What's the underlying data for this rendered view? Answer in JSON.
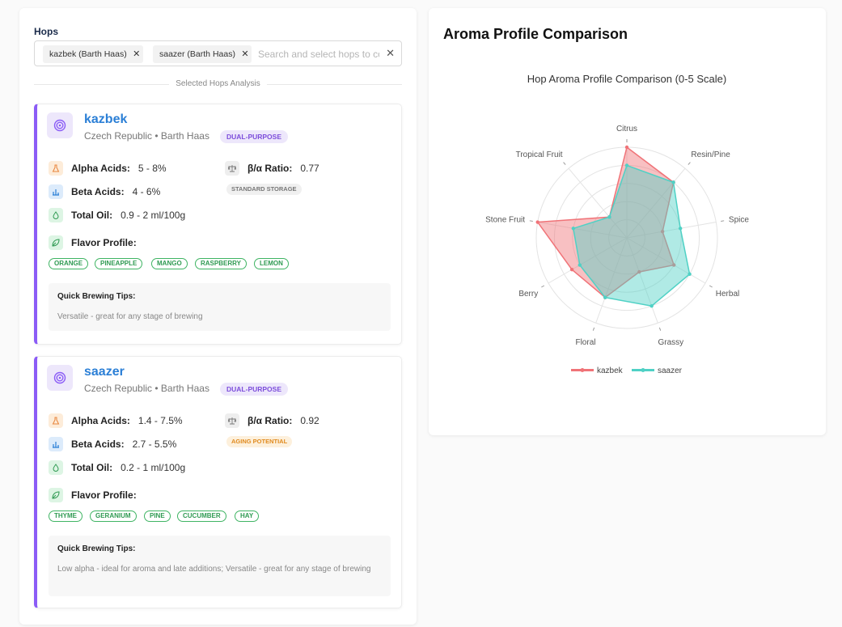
{
  "selector": {
    "label": "Hops",
    "selected": [
      {
        "label": "kazbek (Barth Haas)"
      },
      {
        "label": "saazer (Barth Haas)"
      }
    ],
    "placeholder": "Search and select hops to compare",
    "divider_text": "Selected Hops Analysis"
  },
  "hops": [
    {
      "name": "kazbek",
      "origin": "Czech Republic • Barth Haas",
      "purpose": "DUAL-PURPOSE",
      "alpha_label": "Alpha Acids:",
      "alpha": "5 - 8%",
      "ratio_label": "β/α Ratio:",
      "ratio": "0.77",
      "storage": "STANDARD STORAGE",
      "beta_label": "Beta Acids:",
      "beta": "4 - 6%",
      "oil_label": "Total Oil:",
      "oil": "0.9 - 2 ml/100g",
      "flavor_label": "Flavor Profile:",
      "flavors": [
        "ORANGE",
        "PINEAPPLE",
        "MANGO",
        "RASPBERRY",
        "LEMON"
      ],
      "tips_title": "Quick Brewing Tips:",
      "tips": "Versatile - great for any stage of brewing"
    },
    {
      "name": "saazer",
      "origin": "Czech Republic • Barth Haas",
      "purpose": "DUAL-PURPOSE",
      "alpha_label": "Alpha Acids:",
      "alpha": "1.4 - 7.5%",
      "ratio_label": "β/α Ratio:",
      "ratio": "0.92",
      "storage": "AGING POTENTIAL",
      "beta_label": "Beta Acids:",
      "beta": "2.7 - 5.5%",
      "oil_label": "Total Oil:",
      "oil": "0.2 - 1 ml/100g",
      "flavor_label": "Flavor Profile:",
      "flavors": [
        "THYME",
        "GERANIUM",
        "PINE",
        "CUCUMBER",
        "HAY"
      ],
      "tips_title": "Quick Brewing Tips:",
      "tips": "Low alpha - ideal for aroma and late additions; Versatile - great for any stage of brewing"
    }
  ],
  "chart_panel": {
    "title": "Aroma Profile Comparison"
  },
  "colors": {
    "kazbek": "#f07378",
    "saazer": "#4fd1c5",
    "accent": "#8b5cf6",
    "link": "#2b7fd6"
  },
  "chart_data": {
    "type": "radar",
    "title": "Hop Aroma Profile Comparison (0-5 Scale)",
    "range": [
      0,
      5
    ],
    "grid": true,
    "legend": "bottom",
    "categories": [
      "Citrus",
      "Resin/Pine",
      "Spice",
      "Herbal",
      "Grassy",
      "Floral",
      "Berry",
      "Stone Fruit",
      "Tropical Fruit"
    ],
    "series": [
      {
        "name": "kazbek",
        "values": [
          5.0,
          4.0,
          2.0,
          3.0,
          2.0,
          3.5,
          3.5,
          5.0,
          1.5
        ]
      },
      {
        "name": "saazer",
        "values": [
          4.0,
          4.0,
          3.0,
          4.0,
          4.0,
          3.5,
          3.0,
          3.0,
          1.5
        ]
      }
    ]
  }
}
